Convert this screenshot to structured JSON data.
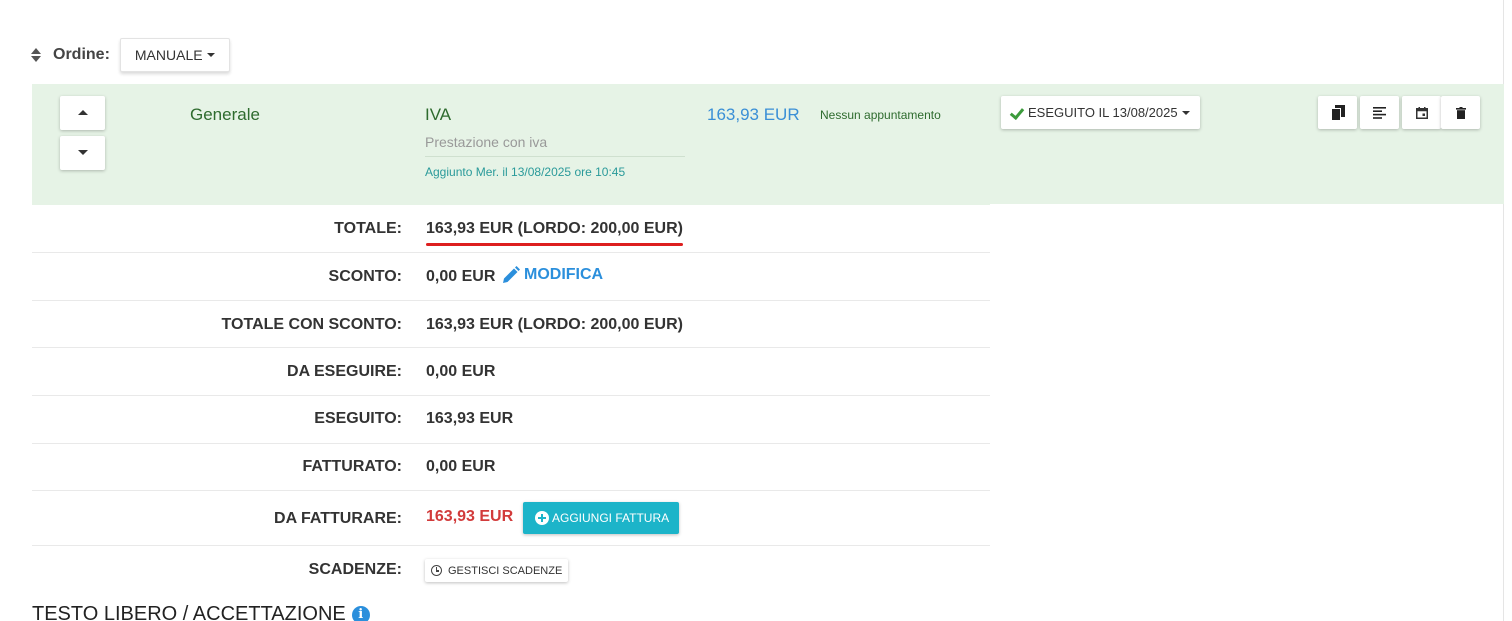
{
  "order": {
    "label": "Ordine:",
    "mode": "MANUALE"
  },
  "item": {
    "category": "Generale",
    "service_name": "IVA",
    "service_description": "Prestazione con iva",
    "added_info": "Aggiunto Mer. il 13/08/2025 ore 10:45",
    "price": "163,93 EUR",
    "appointment": "Nessun appuntamento",
    "status": "ESEGUITO IL 13/08/2025",
    "actions": [
      "copy-icon",
      "text-lines-icon",
      "calendar-icon",
      "trash-icon"
    ]
  },
  "summary": {
    "totale_label": "TOTALE:",
    "totale_value": "163,93 EUR (LORDO: 200,00 EUR)",
    "sconto_label": "SCONTO:",
    "sconto_value": "0,00 EUR",
    "modifica_label": "MODIFICA",
    "totale_sconto_label": "TOTALE CON SCONTO:",
    "totale_sconto_value": "163,93 EUR (LORDO: 200,00 EUR)",
    "da_eseguire_label": "DA ESEGUIRE:",
    "da_eseguire_value": "0,00 EUR",
    "eseguito_label": "ESEGUITO:",
    "eseguito_value": "163,93 EUR",
    "fatturato_label": "FATTURATO:",
    "fatturato_value": "0,00 EUR",
    "da_fatturare_label": "DA FATTURARE:",
    "da_fatturare_value": "163,93 EUR",
    "aggiungi_fattura_label": "AGGIUNGI FATTURA",
    "scadenze_label": "SCADENZE:",
    "gestisci_scadenze_label": "GESTISCI SCADENZE"
  },
  "free_text": {
    "title": "TESTO LIBERO / ACCETTAZIONE"
  },
  "colors": {
    "row_background": "#e6f3e6",
    "accent_blue": "#2b8fdc",
    "teal_button": "#1cb4c9",
    "alert_red": "#d23b3b"
  }
}
